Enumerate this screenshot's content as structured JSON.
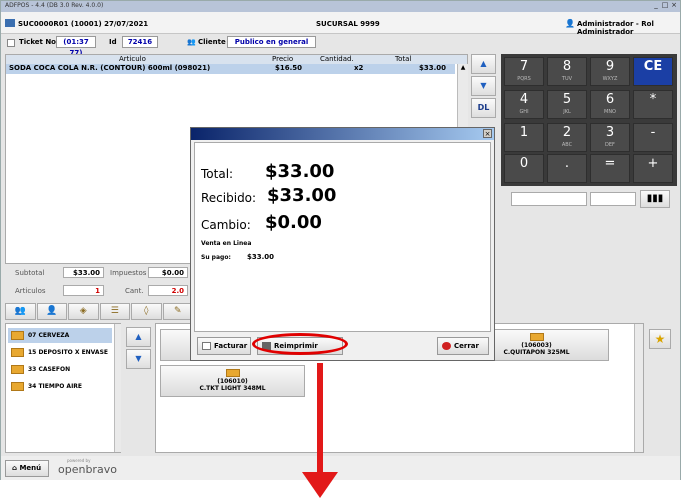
{
  "window": {
    "title": "ADFPOS - 4.4 (DB 3.0  Rev. 4.0.0)"
  },
  "topbar": {
    "session": "SUC0000R01 (10001) 27/07/2021",
    "branch": "SUCURSAL 9999",
    "user": "Administrador - Rol Administrador"
  },
  "ticket": {
    "ticket_label": "Ticket No:",
    "ticket_value": "(01:37 77)",
    "id_label": "Id",
    "id_value": "72416",
    "client_label": "Cliente",
    "client_value": "Publico en general"
  },
  "lines": {
    "headers": {
      "article": "Articulo",
      "price": "Precio",
      "qty": "Cantidad.",
      "total": "Total"
    },
    "rows": [
      {
        "article": "SODA COCA COLA N.R. (CONTOUR) 600ml (098021)",
        "price": "$16.50",
        "qty": "x2",
        "total": "$33.00"
      }
    ]
  },
  "side_buttons": [
    "▲",
    "▼",
    "DL"
  ],
  "keypad": [
    {
      "n": "7",
      "s": "PQRS"
    },
    {
      "n": "8",
      "s": "TUV"
    },
    {
      "n": "9",
      "s": "WXYZ"
    },
    {
      "n": "CE",
      "s": ""
    },
    {
      "n": "4",
      "s": "GHI"
    },
    {
      "n": "5",
      "s": "JKL"
    },
    {
      "n": "6",
      "s": "MNO"
    },
    {
      "n": "*",
      "s": ""
    },
    {
      "n": "1",
      "s": ""
    },
    {
      "n": "2",
      "s": "ABC"
    },
    {
      "n": "3",
      "s": "DEF"
    },
    {
      "n": "-",
      "s": ""
    },
    {
      "n": "0",
      "s": ""
    },
    {
      "n": ".",
      "s": ""
    },
    {
      "n": "=",
      "s": ""
    },
    {
      "n": "+",
      "s": ""
    }
  ],
  "totals": {
    "subtotal_label": "Subtotal",
    "subtotal": "$33.00",
    "taxes_label": "Impuestos",
    "taxes": "$0.00",
    "articles_label": "Articulos",
    "articles": "1",
    "qty_label": "Cant.",
    "qty": "2.0"
  },
  "categories": [
    {
      "label": "07 CERVEZA",
      "selected": true
    },
    {
      "label": "15 DEPOSITO X ENVASE",
      "selected": false
    },
    {
      "label": "33 CASEFON",
      "selected": false
    },
    {
      "label": "34 TIEMPO AIRE",
      "selected": false
    }
  ],
  "products": [
    {
      "code": "(106003)",
      "name": "C.QUITAPON 325ML"
    },
    {
      "code": "(106010)",
      "name": "C.TKT LIGHT 348ML"
    }
  ],
  "bottombar": {
    "menu_label": "Menú",
    "powered": "powered by",
    "brand": "openbravo"
  },
  "dialog": {
    "total_label": "Total:",
    "total": "$33.00",
    "received_label": "Recibido:",
    "received": "$33.00",
    "change_label": "Cambio:",
    "change": "$0.00",
    "sale_type": "Venta en Linea",
    "payment_label": "Su pago:",
    "payment": "$33.00",
    "invoice_button": "Facturar",
    "reprint_button": "Reimprimir",
    "close_button": "Cerrar"
  },
  "colors": {
    "highlight": "#e00000",
    "selected_row": "#bcd1ea",
    "keypad": "#3a3a3a",
    "ce_key": "#1b3fa5"
  }
}
